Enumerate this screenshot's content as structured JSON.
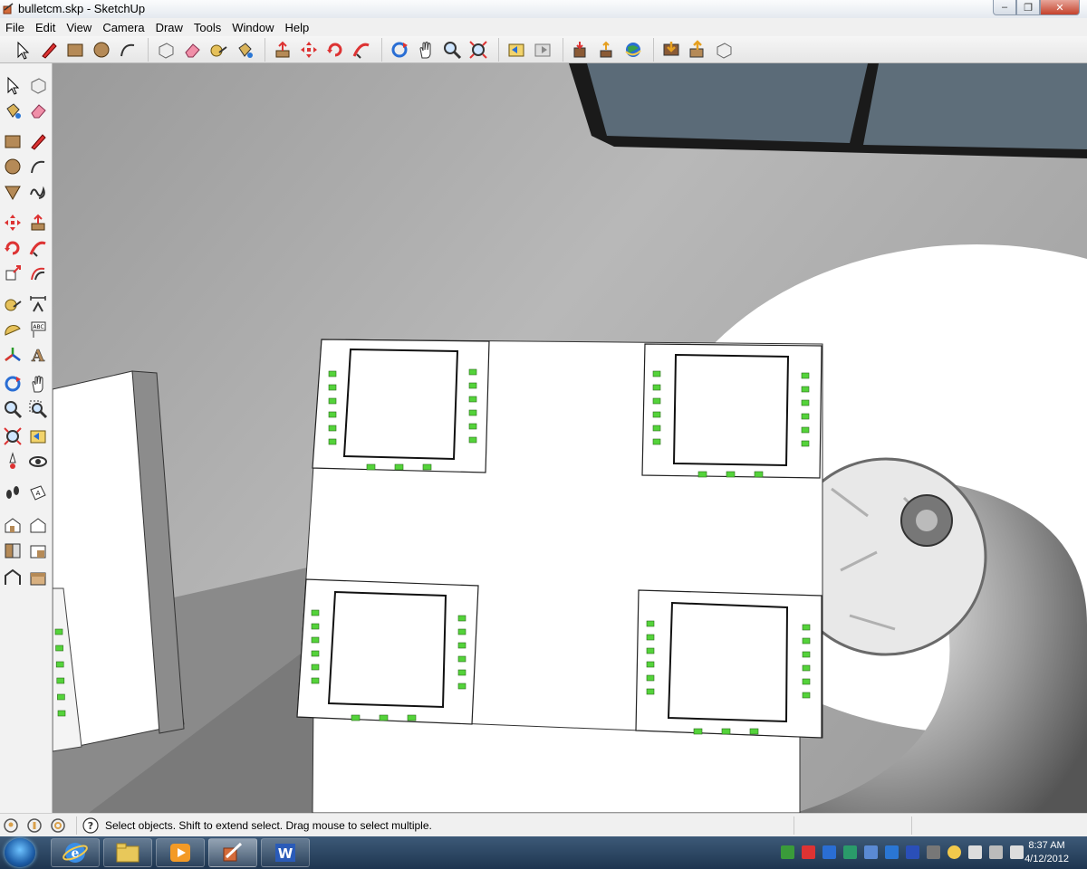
{
  "window": {
    "title": "bulletcm.skp - SketchUp",
    "minimize": "–",
    "maximize": "❐",
    "close": "✕"
  },
  "menu": [
    "File",
    "Edit",
    "View",
    "Camera",
    "Draw",
    "Tools",
    "Window",
    "Help"
  ],
  "toolbar_icons": [
    [
      "select-icon",
      "pencil-icon",
      "rectangle-icon",
      "circle-icon",
      "arc-icon"
    ],
    [
      "make-component-icon",
      "eraser-icon",
      "tape-measure-icon",
      "paint-bucket-icon"
    ],
    [
      "push-pull-icon",
      "move-icon",
      "rotate-icon",
      "follow-me-icon"
    ],
    [
      "orbit-icon",
      "pan-icon",
      "zoom-icon",
      "zoom-extents-icon"
    ],
    [
      "previous-view-icon",
      "next-view-icon"
    ],
    [
      "get-models-icon",
      "share-model-icon",
      "google-earth-icon"
    ],
    [
      "get-photo-texture-icon",
      "upload-icon",
      "component-icon"
    ]
  ],
  "left_tool_icons": [
    "select-icon",
    "make-component-icon",
    "paint-bucket-icon",
    "eraser-icon",
    "rectangle-icon",
    "line-icon",
    "circle-icon",
    "arc-icon",
    "polygon-icon",
    "freehand-icon",
    "move-icon",
    "push-pull-icon",
    "rotate-icon",
    "follow-me-icon",
    "scale-icon",
    "offset-icon",
    "tape-measure-icon",
    "dimension-icon",
    "protractor-icon",
    "text-icon",
    "axes-icon",
    "3d-text-icon",
    "orbit-icon",
    "pan-icon",
    "zoom-icon",
    "zoom-window-icon",
    "zoom-extents-icon",
    "previous-view-icon",
    "position-camera-icon",
    "look-around-icon",
    "walk-icon",
    "section-plane-icon",
    "iso-view-icon",
    "front-view-icon",
    "top-view-icon",
    "right-view-icon",
    "back-view-icon",
    "left-view-icon"
  ],
  "status": {
    "text": "Select objects. Shift to extend select. Drag mouse to select multiple."
  },
  "status_icons": [
    "geo-location-icon",
    "credits-icon",
    "user-icon",
    "help-icon"
  ],
  "taskbar": {
    "items": [
      "start-orb",
      "internet-explorer-icon",
      "file-explorer-icon",
      "media-player-icon",
      "sketchup-taskbar-icon",
      "word-icon"
    ]
  },
  "tray_icons": [
    "shield-icon",
    "tray-app-icon",
    "network-icon",
    "tray-icon",
    "tray-icon",
    "tray-icon",
    "tray-icon",
    "tray-icon",
    "star-icon",
    "tray-icon",
    "display-icon",
    "volume-icon"
  ],
  "clock": {
    "time": "8:37 AM",
    "date": "4/12/2012"
  },
  "colors": {
    "accent_green": "#54d33a",
    "sky_gray": "#a9a9a9",
    "panel_white": "#ffffff",
    "window_dark": "#5b6b78"
  }
}
